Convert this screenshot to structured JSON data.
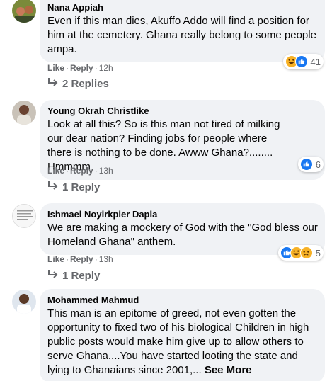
{
  "comments": [
    {
      "author": "Nana Appiah",
      "text": "Even if this man dies, Akuffo Addo will find a position for him at the cemetery. Ghana really belong to some people ampa.",
      "like": "Like",
      "reply": "Reply",
      "time": "12h",
      "replies": "2 Replies",
      "reaction_count": "41",
      "reactions": [
        "haha-icon",
        "like-icon"
      ]
    },
    {
      "author": "Young Okrah Christlike",
      "text": "Look at all this? So is this man not tired of milking our dear nation? Finding jobs for people where there is nothing to be done. Awww Ghana?........ Hmmmm",
      "like": "Like",
      "reply": "Reply",
      "time": "13h",
      "replies": "1 Reply",
      "reaction_count": "6",
      "reactions": [
        "like-icon"
      ]
    },
    {
      "author": "Ishmael Noyirkpier Dapla",
      "text": "We are making a mockery of God with the \"God bless our Homeland Ghana\" anthem.",
      "like": "Like",
      "reply": "Reply",
      "time": "13h",
      "replies": "1 Reply",
      "reaction_count": "5",
      "reactions": [
        "like-icon",
        "haha-icon",
        "sad-icon"
      ]
    },
    {
      "author": "Mohammed Mahmud",
      "text": "This man is an epitome of greed, not even gotten the opportunity to fixed two of his biological Children in high public posts would make him give up to allow others to serve Ghana....You have started looting the state and lying to Ghanaians since 2001,...",
      "see_more": "See More"
    }
  ],
  "colors": {
    "bubble": "#f0f2f5",
    "meta": "#65676b",
    "like_blue": "#1877f2",
    "emoji_yellow": "#f7b125"
  }
}
